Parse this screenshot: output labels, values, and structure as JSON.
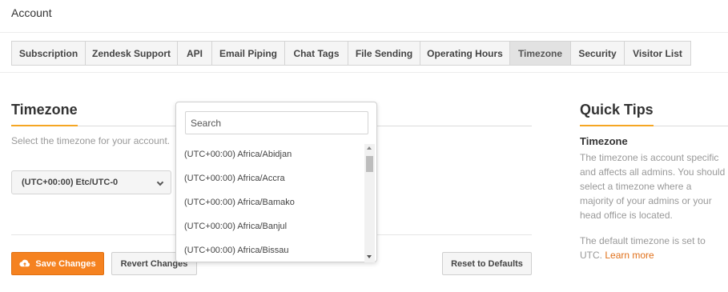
{
  "page": {
    "title": "Account"
  },
  "tabs": [
    {
      "label": "Subscription"
    },
    {
      "label": "Zendesk Support"
    },
    {
      "label": "API"
    },
    {
      "label": "Email Piping"
    },
    {
      "label": "Chat Tags"
    },
    {
      "label": "File Sending"
    },
    {
      "label": "Operating Hours"
    },
    {
      "label": "Timezone",
      "active": true
    },
    {
      "label": "Security"
    },
    {
      "label": "Visitor List"
    }
  ],
  "timezone_section": {
    "title": "Timezone",
    "description": "Select the timezone for your account.",
    "selected_value": "(UTC+00:00) Etc/UTC-0"
  },
  "dropdown": {
    "search_placeholder": "Search",
    "options": [
      "(UTC+00:00) Africa/Abidjan",
      "(UTC+00:00) Africa/Accra",
      "(UTC+00:00) Africa/Bamako",
      "(UTC+00:00) Africa/Banjul",
      "(UTC+00:00) Africa/Bissau"
    ]
  },
  "actions": {
    "save_label": "Save Changes",
    "revert_label": "Revert Changes",
    "reset_label": "Reset to Defaults"
  },
  "quick_tips": {
    "title": "Quick Tips",
    "subtitle": "Timezone",
    "body": "The timezone is account specific and affects all admins. You should select a timezone where a majority of your admins or your head office is located.",
    "body2_prefix": "The default timezone is set to UTC.",
    "link_label": "Learn more"
  },
  "colors": {
    "accent": "#f5a623",
    "primary_button": "#f58220",
    "link": "#e0701a"
  },
  "icons": {
    "save": "cloud-upload-icon",
    "select_caret": "chevron-down-icon"
  }
}
